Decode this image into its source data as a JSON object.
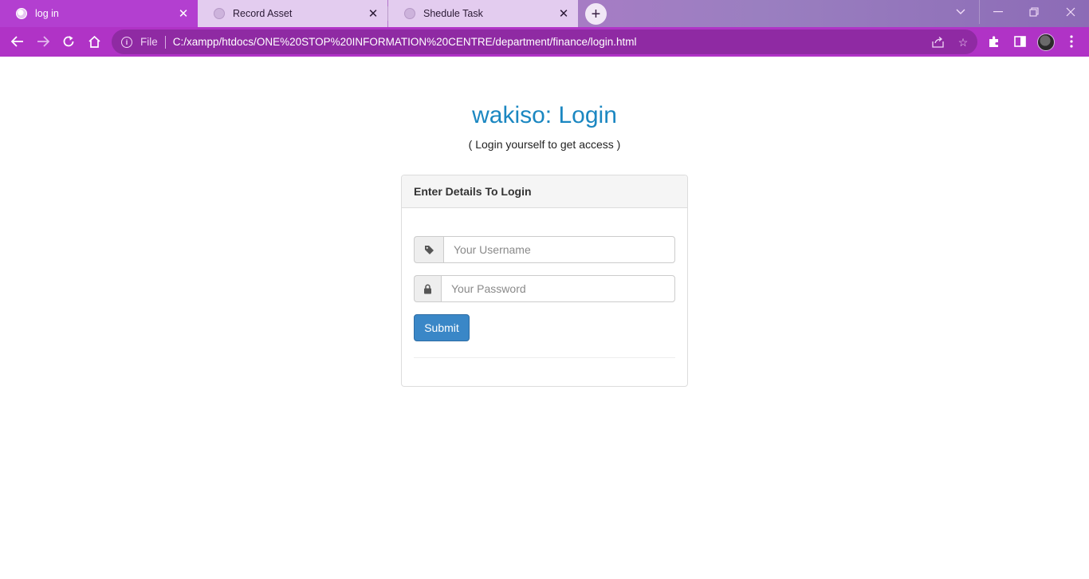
{
  "browser": {
    "tabs": [
      {
        "title": "log in",
        "active": true
      },
      {
        "title": "Record Asset",
        "active": false
      },
      {
        "title": "Shedule Task",
        "active": false
      }
    ],
    "address_bar": {
      "scheme_label": "File",
      "url": "C:/xampp/htdocs/ONE%20STOP%20INFORMATION%20CENTRE/department/finance/login.html"
    },
    "icons": {
      "tab_close": "close-icon",
      "new_tab": "plus-icon",
      "back": "arrow-left-icon",
      "forward": "arrow-right-icon",
      "reload": "reload-icon",
      "home": "home-icon",
      "site_info": "info-icon",
      "share": "share-icon",
      "bookmark": "star-icon",
      "extensions": "puzzle-icon",
      "side_panel": "side-panel-icon",
      "profile": "avatar",
      "menu": "kebab-menu-icon"
    },
    "colors": {
      "tabstrip": "#c34ad8",
      "toolbar": "#b033c6",
      "omnibox": "#8f2aa3"
    }
  },
  "page": {
    "title": "wakiso: Login",
    "subtitle": "( Login yourself to get access )",
    "panel": {
      "heading": "Enter Details To Login",
      "username": {
        "placeholder": "Your Username",
        "value": "",
        "icon": "tag-icon"
      },
      "password": {
        "placeholder": "Your Password",
        "value": "",
        "icon": "lock-icon"
      },
      "submit_label": "Submit"
    },
    "colors": {
      "title": "#1b87c1",
      "button": "#3a87c7"
    }
  }
}
